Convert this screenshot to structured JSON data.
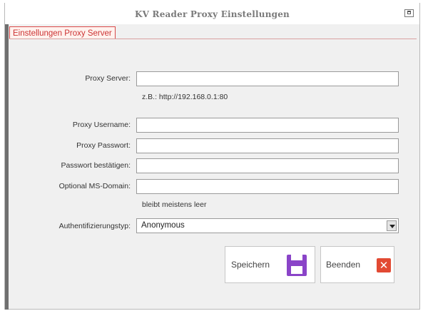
{
  "window": {
    "title": "KV Reader Proxy Einstellungen"
  },
  "tabs": [
    {
      "label": "Einstellungen Proxy Server"
    }
  ],
  "form": {
    "proxy_server": {
      "label": "Proxy Server:",
      "value": "",
      "hint": "z.B.: http://192.168.0.1:80"
    },
    "proxy_username": {
      "label": "Proxy Username:",
      "value": ""
    },
    "proxy_password": {
      "label": "Proxy Passwort:",
      "value": ""
    },
    "password_confirm": {
      "label": "Passwort bestätigen:",
      "value": ""
    },
    "ms_domain": {
      "label": "Optional MS-Domain:",
      "value": "",
      "hint": "bleibt meistens leer"
    },
    "auth_type": {
      "label": "Authentifizierungstyp:",
      "selected": "Anonymous"
    }
  },
  "buttons": {
    "save": {
      "label": "Speichern",
      "icon": "floppy-disk-icon",
      "color": "#8a44c8"
    },
    "exit": {
      "label": "Beenden",
      "icon": "close-x-icon",
      "color": "#e24a33"
    }
  },
  "colors": {
    "tab_border": "#d94a4a",
    "window_bg": "#f0f0f0"
  }
}
